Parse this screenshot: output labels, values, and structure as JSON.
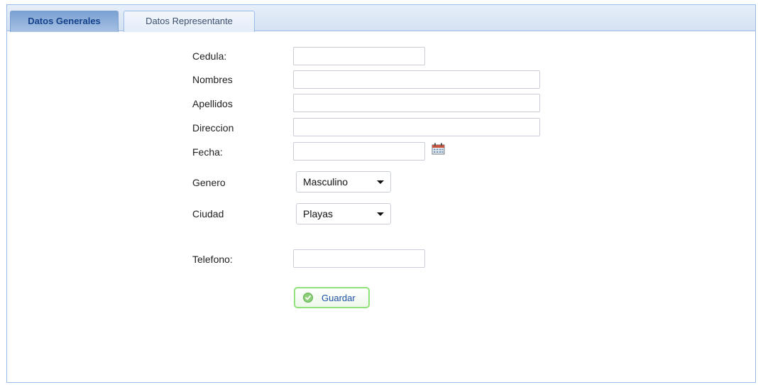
{
  "tabs": [
    {
      "label": "Datos Generales",
      "active": true
    },
    {
      "label": "Datos Representante",
      "active": false
    }
  ],
  "form": {
    "cedula": {
      "label": "Cedula:",
      "value": ""
    },
    "nombres": {
      "label": "Nombres",
      "value": ""
    },
    "apellidos": {
      "label": "Apellidos",
      "value": ""
    },
    "direccion": {
      "label": "Direccion",
      "value": ""
    },
    "fecha": {
      "label": "Fecha:",
      "value": ""
    },
    "genero": {
      "label": "Genero",
      "selected": "Masculino"
    },
    "ciudad": {
      "label": "Ciudad",
      "selected": "Playas"
    },
    "telefono": {
      "label": "Telefono:",
      "value": ""
    }
  },
  "buttons": {
    "save_label": "Guardar",
    "icon": "check-circle-icon"
  },
  "icons": {
    "calendar": "calendar-icon"
  },
  "colors": {
    "tab_active": "#7aa1d2",
    "tab_border": "#99bbe8",
    "button_border": "#8fe27a",
    "button_text": "#1f4ea6"
  }
}
